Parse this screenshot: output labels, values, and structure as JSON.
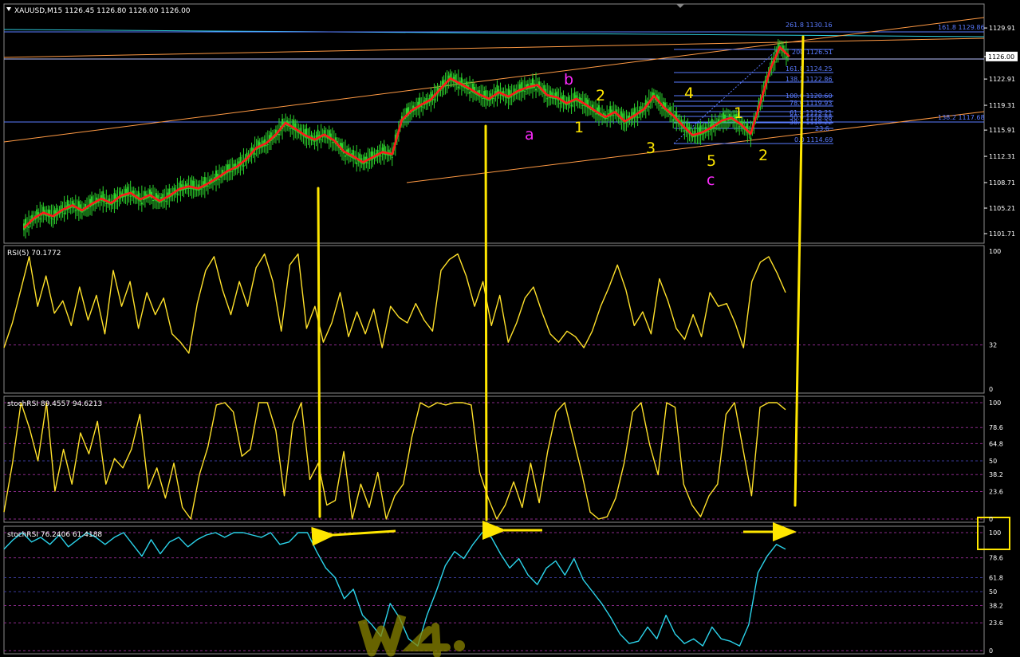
{
  "window": {
    "symbol_header": "XAUUSD,M15  1126.45 1126.80 1126.00 1126.00",
    "colors": {
      "background": "#000000",
      "axis": "#ffffff",
      "grid": "#2a3a80",
      "candle": "#2dd42d",
      "ma": "#ff1a1a",
      "rsi": "#ffe12a",
      "stochrsi": "#ffe12a",
      "stochrsi2": "#2bd3ea",
      "fib": "#5a7bff",
      "channel": "#ff9a44",
      "annotation_yellow": "#ffe600",
      "annotation_magenta": "#ff2bff",
      "price_line": "#b8c2ff"
    }
  },
  "chart_data": [
    {
      "type": "line",
      "name": "price",
      "title": "XAUUSD,M15  1126.45 1126.80 1126.00 1126.00",
      "ylim": [
        1100.4,
        1133.2
      ],
      "yticks": [
        "1129.91",
        "1126.00",
        "1122.91",
        "1119.31",
        "1115.91",
        "1112.31",
        "1108.71",
        "1105.21",
        "1101.71"
      ],
      "current_price": "1126.00",
      "close_series": [
        1102.5,
        1103.8,
        1104.6,
        1104.1,
        1105.0,
        1105.6,
        1104.9,
        1105.8,
        1106.5,
        1105.9,
        1106.9,
        1107.3,
        1106.4,
        1107.0,
        1106.2,
        1106.9,
        1107.8,
        1108.2,
        1107.9,
        1108.6,
        1109.4,
        1110.3,
        1110.9,
        1112.0,
        1113.5,
        1114.1,
        1115.3,
        1116.9,
        1116.1,
        1115.2,
        1114.6,
        1115.3,
        1114.5,
        1113.0,
        1112.3,
        1111.5,
        1112.2,
        1112.9,
        1112.6,
        1117.3,
        1118.6,
        1119.4,
        1120.1,
        1121.6,
        1123.0,
        1122.3,
        1121.6,
        1120.8,
        1120.2,
        1121.1,
        1120.5,
        1121.3,
        1121.8,
        1122.1,
        1120.7,
        1120.4,
        1119.6,
        1120.2,
        1119.4,
        1118.5,
        1117.7,
        1118.4,
        1117.1,
        1117.9,
        1118.8,
        1120.6,
        1119.1,
        1117.9,
        1116.5,
        1115.2,
        1115.6,
        1116.3,
        1117.2,
        1117.6,
        1116.7,
        1115.4,
        1119.7,
        1124.2,
        1127.3,
        1126.0
      ],
      "fib_levels": [
        {
          "label": "261.8 1130.16"
        },
        {
          "label": "161.8 1129.86"
        },
        {
          "label": "200 1126.51"
        },
        {
          "label": "161.8 1124.25"
        },
        {
          "label": "138.2 1122.86"
        },
        {
          "label": "100.0 1120.60"
        },
        {
          "label": "78.6 1119.93"
        },
        {
          "label": "61.8 1119.21"
        },
        {
          "label": "50.0 1118.88"
        },
        {
          "label": "38.2 1118.22"
        },
        {
          "label": "23.6"
        },
        {
          "label": "0.0 1114.69"
        },
        {
          "label": "138.2 1117.68"
        }
      ],
      "annotations": [
        {
          "text": "a",
          "color": "magenta"
        },
        {
          "text": "b",
          "color": "magenta"
        },
        {
          "text": "c",
          "color": "magenta"
        },
        {
          "text": "1",
          "color": "yellow"
        },
        {
          "text": "2",
          "color": "yellow"
        },
        {
          "text": "3",
          "color": "yellow"
        },
        {
          "text": "4",
          "color": "yellow"
        },
        {
          "text": "5",
          "color": "yellow"
        },
        {
          "text": "1",
          "color": "yellow"
        },
        {
          "text": "2",
          "color": "yellow"
        }
      ]
    },
    {
      "type": "line",
      "name": "rsi",
      "title": "RSI(5) 70.1772",
      "ylim": [
        0,
        100
      ],
      "yticks": [
        "100",
        "32",
        "0"
      ],
      "values": [
        30,
        48,
        72,
        96,
        60,
        82,
        55,
        64,
        46,
        74,
        50,
        68,
        40,
        86,
        60,
        78,
        44,
        70,
        54,
        66,
        40,
        34,
        26,
        62,
        86,
        96,
        72,
        54,
        78,
        60,
        88,
        98,
        78,
        42,
        90,
        98,
        44,
        60,
        34,
        48,
        70,
        38,
        56,
        40,
        58,
        30,
        60,
        52,
        48,
        62,
        50,
        42,
        86,
        94,
        98,
        82,
        60,
        78,
        46,
        68,
        34,
        48,
        66,
        74,
        56,
        40,
        34,
        42,
        38,
        30,
        42,
        60,
        74,
        90,
        72,
        46,
        56,
        40,
        80,
        64,
        44,
        36,
        54,
        38,
        70,
        60,
        62,
        48,
        30,
        78,
        92,
        96,
        84,
        70
      ]
    },
    {
      "type": "line",
      "name": "stochrsi",
      "title": "stochRSI 89.4557 94.6213",
      "ylim": [
        0,
        100
      ],
      "yticks": [
        "100",
        "78.6",
        "64.8",
        "50",
        "38.2",
        "23.6",
        "0"
      ],
      "values": [
        6,
        48,
        100,
        78,
        50,
        100,
        24,
        60,
        30,
        74,
        56,
        84,
        30,
        52,
        44,
        60,
        90,
        26,
        44,
        18,
        48,
        10,
        0,
        38,
        62,
        98,
        100,
        92,
        54,
        60,
        100,
        100,
        76,
        20,
        82,
        100,
        34,
        48,
        12,
        16,
        58,
        0,
        30,
        10,
        40,
        0,
        20,
        30,
        70,
        100,
        96,
        100,
        98,
        100,
        100,
        98,
        40,
        18,
        0,
        12,
        32,
        10,
        48,
        14,
        58,
        92,
        100,
        70,
        40,
        6,
        0,
        2,
        18,
        48,
        92,
        100,
        64,
        38,
        100,
        96,
        30,
        12,
        2,
        20,
        30,
        90,
        100,
        60,
        20,
        96,
        100,
        100,
        94
      ]
    },
    {
      "type": "line",
      "name": "stochrsi2",
      "title": "stochRSI 76.2406 61.4188",
      "ylim": [
        0,
        100
      ],
      "yticks": [
        "100",
        "78.6",
        "61.8",
        "50",
        "38.2",
        "23.6",
        "0"
      ],
      "values": [
        86,
        94,
        100,
        92,
        96,
        90,
        98,
        88,
        94,
        100,
        96,
        90,
        96,
        100,
        90,
        80,
        94,
        82,
        92,
        96,
        88,
        94,
        98,
        100,
        96,
        100,
        100,
        98,
        96,
        100,
        90,
        92,
        100,
        100,
        84,
        70,
        62,
        44,
        52,
        30,
        22,
        12,
        40,
        28,
        10,
        4,
        30,
        50,
        72,
        84,
        78,
        90,
        100,
        96,
        82,
        70,
        78,
        64,
        56,
        70,
        76,
        64,
        78,
        60,
        50,
        40,
        28,
        14,
        6,
        8,
        20,
        10,
        30,
        14,
        6,
        10,
        4,
        20,
        10,
        8,
        4,
        22,
        66,
        80,
        90,
        86
      ]
    }
  ]
}
